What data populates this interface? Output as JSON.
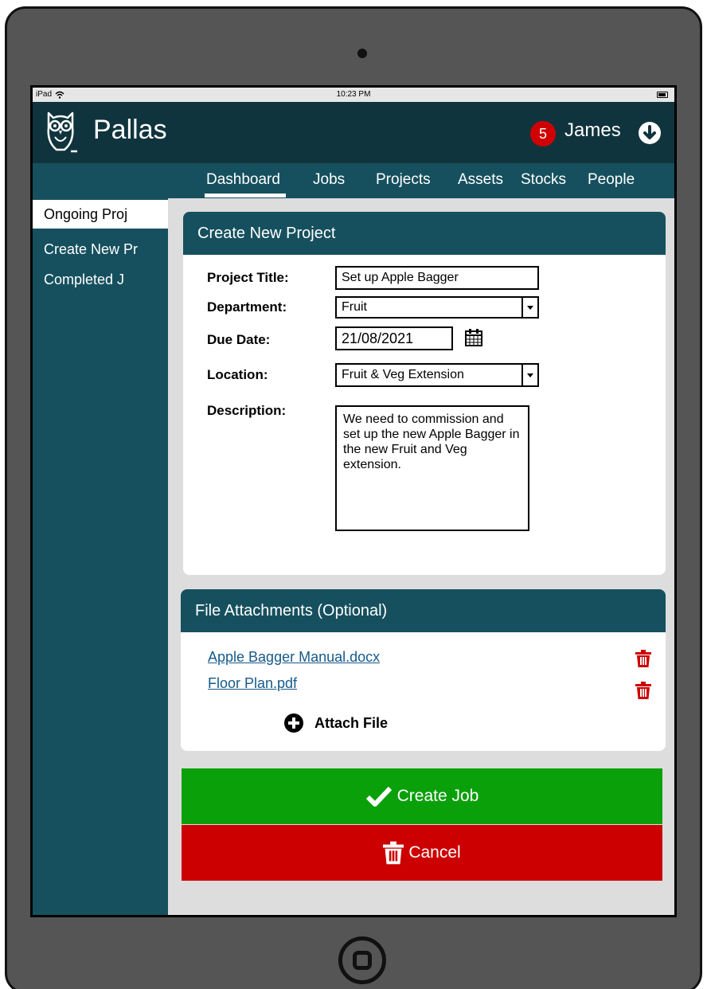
{
  "status_bar": {
    "device": "iPad",
    "time": "10:23 PM"
  },
  "header": {
    "app_title": "Pallas",
    "notification_count": "5",
    "user_name": "James"
  },
  "nav": {
    "tabs": [
      "Dashboard",
      "Jobs",
      "Projects",
      "Assets",
      "Stocks",
      "People"
    ],
    "active": "Dashboard"
  },
  "sidebar": {
    "items": [
      "Ongoing Proj",
      "Create New Pr",
      "Completed J"
    ],
    "active": "Ongoing Proj"
  },
  "form": {
    "heading": "Create New Project",
    "title_label": "Project Title:",
    "title_value": "Set up Apple Bagger",
    "department_label": "Department:",
    "department_value": "Fruit",
    "due_label": "Due Date:",
    "due_value": "21/08/2021",
    "location_label": "Location:",
    "location_value": "Fruit & Veg Extension",
    "description_label": "Description:",
    "description_value": "We need to commission and set up the new Apple Bagger in the new Fruit and Veg extension."
  },
  "attachments": {
    "heading": "File Attachments (Optional)",
    "files": [
      "Apple Bagger Manual.docx",
      "Floor Plan.pdf"
    ],
    "attach_label": "Attach File"
  },
  "actions": {
    "create_label": "Create Job",
    "cancel_label": "Cancel"
  },
  "colors": {
    "header": "#10343d",
    "nav": "#16505e",
    "create": "#0aa00a",
    "cancel": "#cc0000",
    "link": "#155a8a",
    "trash": "#cc0000"
  },
  "icons": [
    "owl-logo-icon",
    "wifi-icon",
    "battery-icon",
    "chevron-down-circle-icon",
    "calendar-icon",
    "trash-icon",
    "plus-circle-icon",
    "check-icon",
    "home-button-icon"
  ]
}
